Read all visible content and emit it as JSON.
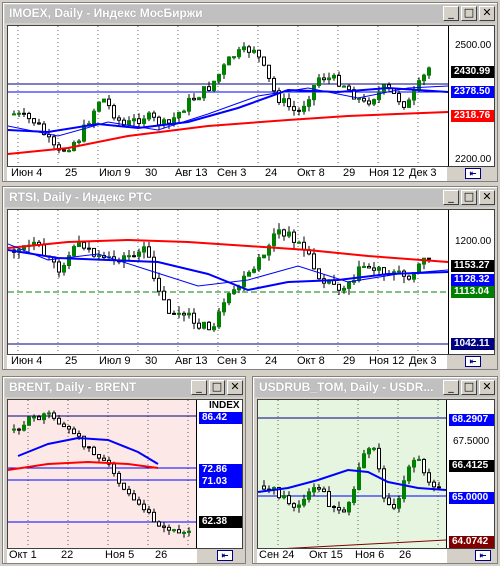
{
  "windows": {
    "imoex": {
      "title": "IMOEX, Daily - Индекс МосБиржи",
      "xlabels": [
        "Июн 4",
        "25",
        "Июл 9",
        "30",
        "Авг 13",
        "Сен 3",
        "24",
        "Окт 8",
        "29",
        "Ноя 12",
        "Дек 3"
      ],
      "yticks": [
        "2500.00",
        "2200.00"
      ],
      "tags": [
        {
          "value": "2430.99",
          "bg": "#000000",
          "fg": "#ffffff"
        },
        {
          "value": "2378.50",
          "bg": "#0000ff",
          "fg": "#ffffff"
        },
        {
          "value": "2318.76",
          "bg": "#ff0000",
          "fg": "#ffffff"
        }
      ]
    },
    "rtsi": {
      "title": "RTSI, Daily - Индекс РТС",
      "xlabels": [
        "Июн 4",
        "25",
        "Июл 9",
        "30",
        "Авг 13",
        "Сен 3",
        "24",
        "Окт 8",
        "29",
        "Ноя 12",
        "Дек 3"
      ],
      "yticks": [
        "1200.00"
      ],
      "tags": [
        {
          "value": "1153.27",
          "bg": "#000000",
          "fg": "#ffffff"
        },
        {
          "value": "1128.32",
          "bg": "#0000ff",
          "fg": "#ffffff"
        },
        {
          "value": "1113.04",
          "bg": "#008000",
          "fg": "#ffffff"
        },
        {
          "value": "1042.11",
          "bg": "#000080",
          "fg": "#ffffff"
        }
      ]
    },
    "brent": {
      "title": "BRENT, Daily - BRENT",
      "scale_header": "INDEX",
      "xlabels": [
        "Окт 1",
        "22",
        "Ноя 5",
        "26"
      ],
      "tags": [
        {
          "value": "86.42",
          "bg": "#0000ff",
          "fg": "#ffffff"
        },
        {
          "value": "72.86",
          "bg": "#0000ff",
          "fg": "#ffffff"
        },
        {
          "value": "71.03",
          "bg": "#0000ff",
          "fg": "#ffffff"
        },
        {
          "value": "62.38",
          "bg": "#000000",
          "fg": "#ffffff"
        }
      ]
    },
    "usdrub": {
      "title": "USDRUB_TOM, Daily - USDR...",
      "xlabels": [
        "Сен 24",
        "Окт 15",
        "Ноя 6",
        "26"
      ],
      "yticks": [
        "67.5000"
      ],
      "tags": [
        {
          "value": "68.2907",
          "bg": "#0000ff",
          "fg": "#ffffff"
        },
        {
          "value": "66.4125",
          "bg": "#000000",
          "fg": "#ffffff"
        },
        {
          "value": "65.0000",
          "bg": "#0000ff",
          "fg": "#ffffff"
        },
        {
          "value": "64.0742",
          "bg": "#800000",
          "fg": "#ffffff"
        }
      ]
    }
  },
  "buttons": {
    "minimize": "_",
    "maximize": "□",
    "close": "✕",
    "scroll": "⇤"
  },
  "colors": {
    "candle_up": "#008000",
    "candle_down": "#000000",
    "ma_fast": "#0000ff",
    "ma_slow": "#ff0000",
    "grid": "#000000"
  }
}
